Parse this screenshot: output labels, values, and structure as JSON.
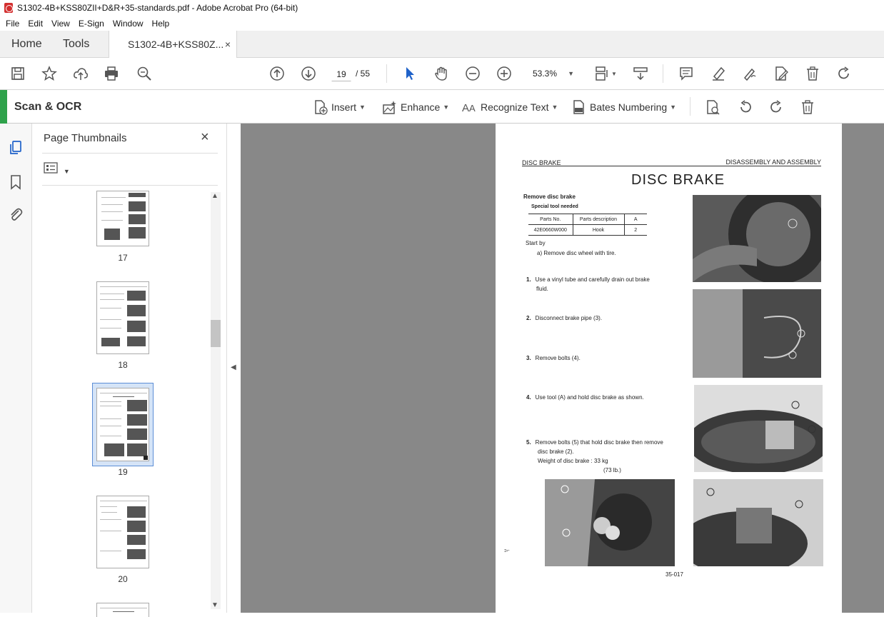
{
  "window": {
    "title": "S1302-4B+KSS80ZII+D&R+35-standards.pdf - Adobe Acrobat Pro (64-bit)"
  },
  "menu": [
    "File",
    "Edit",
    "View",
    "E-Sign",
    "Window",
    "Help"
  ],
  "tabs": {
    "home": "Home",
    "tools": "Tools",
    "document": "S1302-4B+KSS80Z...",
    "close": "×"
  },
  "toolbar": {
    "page_current": "19",
    "page_total": "/ 55",
    "zoom": "53.3%"
  },
  "tool_panel": {
    "title": "Scan & OCR",
    "insert": "Insert",
    "enhance": "Enhance",
    "recognize": "Recognize Text",
    "bates": "Bates Numbering"
  },
  "thumbnails": {
    "title": "Page Thumbnails",
    "close": "×",
    "pages": [
      "17",
      "18",
      "19",
      "20"
    ],
    "selected": "19"
  },
  "document": {
    "header_left": "DISC BRAKE",
    "header_right": "DISASSEMBLY AND ASSEMBLY",
    "title": "DISC BRAKE",
    "section": "Remove disc brake",
    "subsection": "Special tool needed",
    "table_headers": [
      "Parts No.",
      "Parts description",
      "A"
    ],
    "table_row": [
      "42E0660W000",
      "Hook",
      "2"
    ],
    "start_by": "Start by",
    "start_item": "a)   Remove disc wheel with tire.",
    "steps": [
      {
        "num": "1.",
        "line1": "Use a vinyl tube and carefully drain out brake",
        "line2": "fluid."
      },
      {
        "num": "2.",
        "line1": "Disconnect brake pipe (3).",
        "line2": ""
      },
      {
        "num": "3.",
        "line1": "Remove bolts (4).",
        "line2": ""
      },
      {
        "num": "4.",
        "line1": "Use tool (A) and hold disc brake as shown.",
        "line2": ""
      },
      {
        "num": "5.",
        "line1": "Remove bolts (5) that hold disc brake then remove",
        "line2": "disc brake (2)."
      }
    ],
    "weight_line": "Weight of disc brake :  33 kg",
    "weight_lb": "(73 lb.)",
    "footer": "35-017",
    "margin_mark": "ɔ⌐"
  },
  "colors": {
    "accent_green": "#2fa24b",
    "selection": "#d5e4f7",
    "viewport_bg": "#888888"
  }
}
